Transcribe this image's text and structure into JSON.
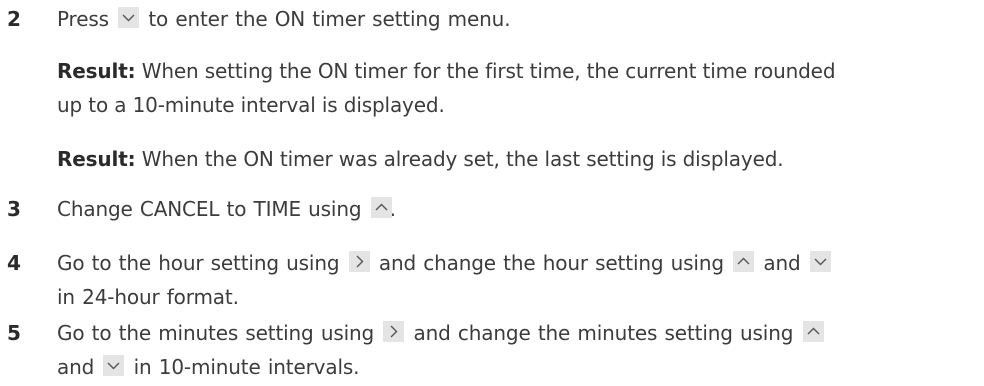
{
  "steps": [
    {
      "number": "2",
      "parts": {
        "a": "Press",
        "b": "to enter the ON timer setting menu."
      }
    },
    {
      "number": "3",
      "parts": {
        "a": "Change CANCEL to TIME using",
        "b": "."
      }
    },
    {
      "number": "4",
      "parts": {
        "a": "Go to the hour setting using",
        "b": "and change the hour setting using",
        "c": "and",
        "d": "in 24-hour format."
      }
    },
    {
      "number": "5",
      "parts": {
        "a": "Go to the minutes setting using",
        "b": "and change the minutes setting using",
        "c": "and",
        "d": "in 10-minute intervals."
      }
    }
  ],
  "results": [
    {
      "label": "Result:",
      "line1": "When setting the ON timer for the first time, the current time rounded",
      "line2": "up to a 10-minute interval is displayed."
    },
    {
      "label": "Result:",
      "line1": "When the ON timer was already set, the last setting is displayed."
    }
  ],
  "icons": {
    "down": "chevron-down-icon",
    "up": "chevron-up-icon",
    "right": "chevron-right-icon"
  },
  "colors": {
    "text": "#3c3c3c",
    "icon_bg": "#e4e4e4",
    "icon_stroke": "#555555"
  }
}
